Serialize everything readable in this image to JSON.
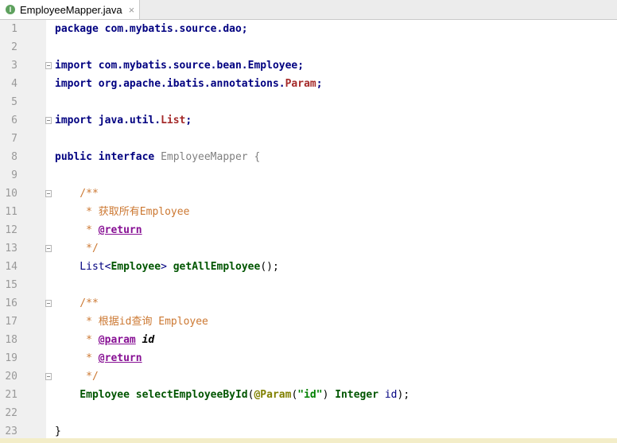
{
  "tab": {
    "label": "EmployeeMapper.java",
    "icon": "interface-file-icon",
    "close": "×"
  },
  "line_numbers": [
    "1",
    "2",
    "3",
    "4",
    "5",
    "6",
    "7",
    "8",
    "9",
    "10",
    "11",
    "12",
    "13",
    "14",
    "15",
    "16",
    "17",
    "18",
    "19",
    "20",
    "21",
    "22",
    "23"
  ],
  "code": {
    "l1": {
      "kw": "package",
      "rest": " com.mybatis.source.dao;"
    },
    "l3": {
      "kw": "import",
      "rest": " com.mybatis.source.bean.Employee;"
    },
    "l4": {
      "kw": "import",
      "rest": " org.apache.ibatis.annotations.",
      "cls": "Param",
      "end": ";"
    },
    "l6": {
      "kw": "import",
      "rest": " java.util.",
      "cls": "List",
      "end": ";"
    },
    "l8": {
      "kw": "public interface",
      "name": "EmployeeMapper",
      "brace": "{"
    },
    "l10": {
      "text": "    /**"
    },
    "l11": {
      "text": "     * 获取所有Employee"
    },
    "l12": {
      "star": "     * ",
      "tag": "@return"
    },
    "l13": {
      "text": "     */"
    },
    "l14": {
      "a": "    List<",
      "b": "Employee",
      "c": "> ",
      "m": "getAllEmployee",
      "d": "();"
    },
    "l16": {
      "text": "    /**"
    },
    "l17": {
      "text": "     * 根据id查询 Employee"
    },
    "l18": {
      "star": "     * ",
      "tag": "@param",
      "param": " id"
    },
    "l19": {
      "star": "     * ",
      "tag": "@return"
    },
    "l20": {
      "text": "     */"
    },
    "l21": {
      "ret": "    Employee",
      "m": " selectEmployeeById",
      "open": "(",
      "ann": "@Param",
      "p1": "(",
      "s": "\"id\"",
      "p2": ")",
      "type": " Integer",
      "arg": " id",
      "end": ");"
    },
    "l23": {
      "text": "}"
    }
  }
}
